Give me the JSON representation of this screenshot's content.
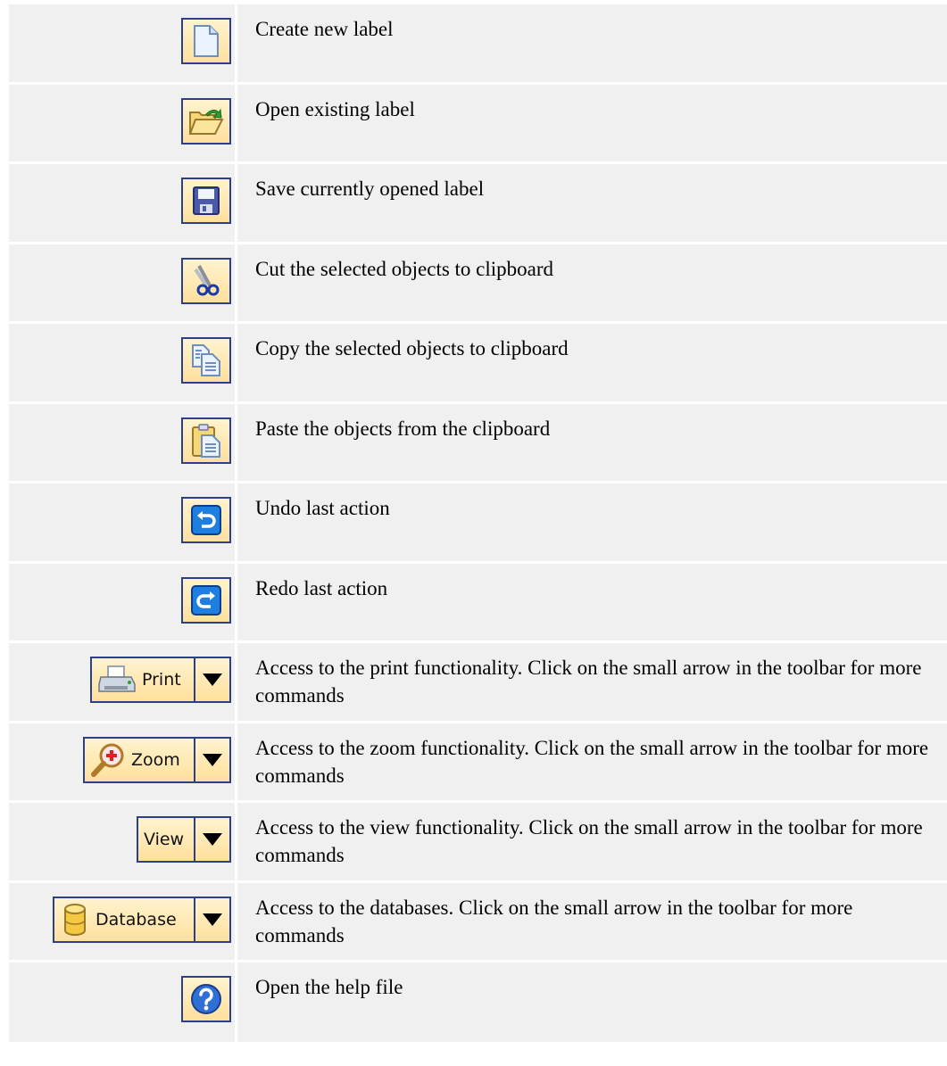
{
  "rows": [
    {
      "icon": "new-document-icon",
      "text": "Create new label"
    },
    {
      "icon": "open-folder-icon",
      "text": "Open existing label"
    },
    {
      "icon": "save-disk-icon",
      "text": "Save currently opened label"
    },
    {
      "icon": "scissors-icon",
      "text": "Cut the selected objects to clipboard"
    },
    {
      "icon": "copy-icon",
      "text": "Copy the selected objects to clipboard"
    },
    {
      "icon": "paste-clipboard-icon",
      "text": "Paste the objects from the clipboard"
    },
    {
      "icon": "undo-icon",
      "text": "Undo last action"
    },
    {
      "icon": "redo-icon",
      "text": "Redo last action"
    },
    {
      "icon": "printer-icon",
      "button_label": "Print",
      "text": "Access to the print functionality. Click on the small arrow in the toolbar for more commands"
    },
    {
      "icon": "zoom-magnifier-icon",
      "button_label": "Zoom",
      "text": "Access to the zoom functionality. Click on the small arrow in the toolbar for more commands"
    },
    {
      "icon": "",
      "button_label": "View",
      "text": "Access to the view functionality. Click on the small arrow in the toolbar for more commands"
    },
    {
      "icon": "database-icon",
      "button_label": "Database",
      "text": "Access to the databases. Click on the small arrow in the toolbar for more commands"
    },
    {
      "icon": "help-icon",
      "text": "Open the help file"
    }
  ],
  "colors": {
    "row_bg": "#f0f0f0",
    "button_border": "#2c3f8a",
    "button_fill": "#ffe09c"
  }
}
